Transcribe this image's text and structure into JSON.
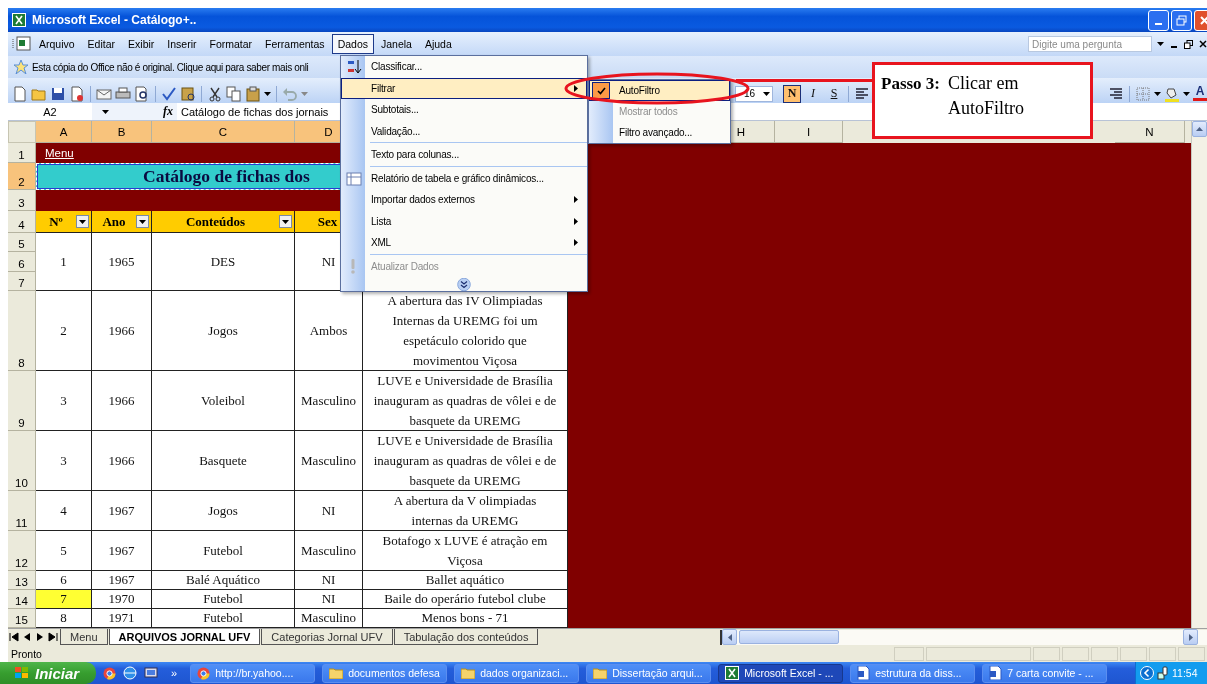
{
  "window": {
    "title": "Microsoft Excel - Catálogo+.."
  },
  "menu_bar": [
    {
      "label": "Arquivo",
      "selected": false
    },
    {
      "label": "Editar",
      "selected": false
    },
    {
      "label": "Exibir",
      "selected": false
    },
    {
      "label": "Inserir",
      "selected": false
    },
    {
      "label": "Formatar",
      "selected": false
    },
    {
      "label": "Ferramentas",
      "selected": false
    },
    {
      "label": "Dados",
      "selected": true
    },
    {
      "label": "Janela",
      "selected": false
    },
    {
      "label": "Ajuda",
      "selected": false
    }
  ],
  "help_search": {
    "placeholder": "Digite uma pergunta"
  },
  "info_bar": {
    "text": "Esta cópia do Office não é original.  Clique aqui para saber mais onli"
  },
  "format_toolbar": {
    "font_size": "16",
    "style_buttons": [
      {
        "label": "N",
        "on": true
      },
      {
        "label": "I",
        "on": false
      },
      {
        "label": "S",
        "on": false
      }
    ],
    "font_color_label": "A"
  },
  "formula_bar": {
    "name_box": "A2",
    "function_label": "fx",
    "value": "Catálogo de fichas dos jornais"
  },
  "column_headers": [
    {
      "label": "A",
      "selected": true
    },
    {
      "label": "B",
      "selected": true
    },
    {
      "label": "C",
      "selected": true
    },
    {
      "label": "D",
      "selected": true
    },
    {
      "label": "H",
      "selected": false
    },
    {
      "label": "I",
      "selected": false
    },
    {
      "label": "N",
      "selected": false
    }
  ],
  "sheet_rows": [
    {
      "kind": "link",
      "row_numbers": [
        {
          "label": "1",
          "selected": false
        }
      ],
      "text": "Menu"
    },
    {
      "kind": "title",
      "row_numbers": [
        {
          "label": "2",
          "selected": true
        }
      ],
      "text": "Catálogo de fichas dos"
    },
    {
      "kind": "band",
      "row_numbers": [
        {
          "label": "3",
          "selected": false
        }
      ]
    },
    {
      "kind": "header",
      "row_numbers": [
        {
          "label": "4",
          "selected": false
        }
      ],
      "cells": [
        "Nº",
        "Ano",
        "Conteúdos",
        "Sex"
      ]
    },
    {
      "kind": "data",
      "row_numbers": [
        {
          "label": "5",
          "selected": false
        },
        {
          "label": "6",
          "selected": false
        },
        {
          "label": "7",
          "selected": false
        }
      ],
      "cells": [
        "1",
        "1965",
        "DES",
        "NI"
      ],
      "highlight": false
    },
    {
      "kind": "data",
      "row_numbers": [
        {
          "label": "8",
          "selected": false
        }
      ],
      "cells": [
        "2",
        "1966",
        "Jogos",
        "Ambos",
        "A abertura das IV Olimpiadas\nInternas da UREMG foi um\nespetáculo colorido que\nmovimentou Viçosa"
      ],
      "highlight": false
    },
    {
      "kind": "data",
      "row_numbers": [
        {
          "label": "9",
          "selected": false
        }
      ],
      "cells": [
        "3",
        "1966",
        "Voleibol",
        "Masculino",
        "LUVE e Universidade de Brasília\ninauguram as quadras de vôlei e de\nbasquete da UREMG"
      ],
      "highlight": false
    },
    {
      "kind": "data",
      "row_numbers": [
        {
          "label": "10",
          "selected": false
        }
      ],
      "cells": [
        "3",
        "1966",
        "Basquete",
        "Masculino",
        "LUVE e Universidade de Brasília\ninauguram as quadras de vôlei e de\nbasquete da UREMG"
      ],
      "highlight": false
    },
    {
      "kind": "data",
      "row_numbers": [
        {
          "label": "11",
          "selected": false
        }
      ],
      "cells": [
        "4",
        "1967",
        "Jogos",
        "NI",
        "A abertura da V olimpiadas\ninternas da UREMG"
      ],
      "highlight": false
    },
    {
      "kind": "data",
      "row_numbers": [
        {
          "label": "12",
          "selected": false
        }
      ],
      "cells": [
        "5",
        "1967",
        "Futebol",
        "Masculino",
        "Botafogo x LUVE é atração em\nViçosa"
      ],
      "highlight": false
    },
    {
      "kind": "data",
      "row_numbers": [
        {
          "label": "13",
          "selected": false
        }
      ],
      "cells": [
        "6",
        "1967",
        "Balé Aquático",
        "NI",
        "Ballet aquático"
      ],
      "highlight": false
    },
    {
      "kind": "data",
      "row_numbers": [
        {
          "label": "14",
          "selected": false
        }
      ],
      "cells": [
        "7",
        "1970",
        "Futebol",
        "NI",
        "Baile do operário futebol clube"
      ],
      "highlight": true
    },
    {
      "kind": "data",
      "row_numbers": [
        {
          "label": "15",
          "selected": false
        }
      ],
      "cells": [
        "8",
        "1971",
        "Futebol",
        "Masculino",
        "Menos bons - 71"
      ],
      "highlight": false
    }
  ],
  "data_menu": {
    "items": [
      {
        "label": "Classificar...",
        "kind": "sort",
        "selected": false,
        "disabled": false,
        "submenu": false,
        "separator_before": false
      },
      {
        "label": "Filtrar",
        "selected": true,
        "disabled": false,
        "submenu": true,
        "separator_before": false
      },
      {
        "label": "Subtotais...",
        "selected": false,
        "disabled": false,
        "submenu": false,
        "separator_before": false
      },
      {
        "label": "Validação...",
        "selected": false,
        "disabled": false,
        "submenu": false,
        "separator_before": false
      },
      {
        "label": "Texto para colunas...",
        "selected": false,
        "disabled": false,
        "submenu": false,
        "separator_before": true
      },
      {
        "label": "Relatório de tabela e gráfico dinâmicos...",
        "kind": "pivot",
        "selected": false,
        "disabled": false,
        "submenu": false,
        "separator_before": true
      },
      {
        "label": "Importar dados externos",
        "selected": false,
        "disabled": false,
        "submenu": true,
        "separator_before": false
      },
      {
        "label": "Lista",
        "selected": false,
        "disabled": false,
        "submenu": true,
        "separator_before": false
      },
      {
        "label": "XML",
        "selected": false,
        "disabled": false,
        "submenu": true,
        "separator_before": false
      },
      {
        "label": "Atualizar Dados",
        "kind": "refresh",
        "selected": false,
        "disabled": true,
        "submenu": false,
        "separator_before": true
      }
    ]
  },
  "filter_submenu": {
    "items": [
      {
        "label": "AutoFiltro",
        "selected": true,
        "checked": true,
        "disabled": false
      },
      {
        "label": "Mostrar todos",
        "selected": false,
        "checked": false,
        "disabled": true
      },
      {
        "label": "Filtro avançado...",
        "selected": false,
        "checked": false,
        "disabled": false
      }
    ]
  },
  "callout": {
    "title": "Passo 3:",
    "text": "Clicar em\nAutoFiltro"
  },
  "sheet_tabs": [
    {
      "label": "Menu",
      "selected": false
    },
    {
      "label": "ARQUIVOS JORNAL UFV",
      "selected": true
    },
    {
      "label": "Categorias Jornal UFV",
      "selected": false
    },
    {
      "label": "Tabulação dos conteúdos",
      "selected": false
    }
  ],
  "status_bar": {
    "text": "Pronto"
  },
  "taskbar": {
    "start": "Iniciar",
    "overflow": "»",
    "tasks": [
      {
        "label": "http://br.yahoo....",
        "kind": "browser",
        "selected": false
      },
      {
        "label": "documentos defesa",
        "kind": "folder",
        "selected": false
      },
      {
        "label": "dados organizaci...",
        "kind": "folder",
        "selected": false
      },
      {
        "label": "Dissertação arqui...",
        "kind": "folder",
        "selected": false
      },
      {
        "label": "Microsoft Excel - ...",
        "kind": "excel",
        "selected": true
      },
      {
        "label": "estrutura da diss...",
        "kind": "word",
        "selected": false
      },
      {
        "label": "7 carta convite - ...",
        "kind": "word",
        "selected": false
      }
    ],
    "clock": "11:54"
  }
}
